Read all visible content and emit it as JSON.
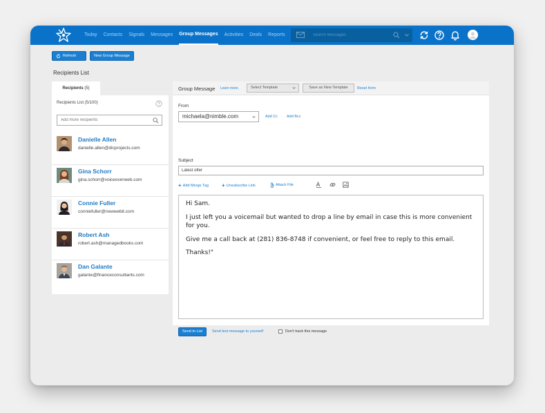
{
  "nav": {
    "items": [
      {
        "label": "Today",
        "active": false
      },
      {
        "label": "Contacts",
        "active": false
      },
      {
        "label": "Signals",
        "active": false
      },
      {
        "label": "Messages",
        "active": false
      },
      {
        "label": "Group Messages",
        "active": true
      },
      {
        "label": "Activities",
        "active": false
      },
      {
        "label": "Deals",
        "active": false
      },
      {
        "label": "Reports",
        "active": false
      }
    ],
    "search_placeholder": "Search Messages"
  },
  "toolbar": {
    "refresh_label": "Refresh",
    "new_group_label": "New Group Message"
  },
  "recipients": {
    "section_title": "Recipients List",
    "tab_label": "Recipients",
    "tab_count": "(5)",
    "list_count": "Recipients List (5/100)",
    "add_placeholder": "Add more recipients",
    "contacts": [
      {
        "name": "Danielle Allen",
        "email": "danielle.allen@dicprojects.com"
      },
      {
        "name": "Gina Schorr",
        "email": "gina.schorr@voiceoverweb.com"
      },
      {
        "name": "Connie Fuller",
        "email": "conniefuller@newwebit.com"
      },
      {
        "name": "Robert Ash",
        "email": "robert.ash@managedbooks.com"
      },
      {
        "name": "Dan Galante",
        "email": "galante@financeconsultants.com"
      }
    ]
  },
  "composer": {
    "title": "Group Message",
    "learn_more": "Learn more.",
    "select_template": "Select Template",
    "save_template": "Save as New Template",
    "reset_form": "Reset form",
    "from_label": "From",
    "from_value": "michaela@nimble.com",
    "add_cc": "Add Cc",
    "add_bcc": "Add Bcc",
    "subject_label": "Subject",
    "subject_value": "Latest offer",
    "add_merge_tag": "Add Merge Tag",
    "unsubscribe_link": "Unsubscribe Link",
    "attach_file": "Attach File",
    "body": [
      "Hi Sam.",
      "I just left you a voicemail but wanted to drop a line by email in case this is more convenient for you.",
      "Give me a call back at  (281) 836-8748 if convenient, or feel free to reply to this email.",
      "Thanks!\""
    ],
    "send_label": "Send to List",
    "test_label": "Send test message to yourself",
    "dont_track": "Don't track this message"
  },
  "colors": {
    "brand": "#0a73c9",
    "link": "#1a7fd0",
    "contact_name": "#1f7ac4"
  }
}
